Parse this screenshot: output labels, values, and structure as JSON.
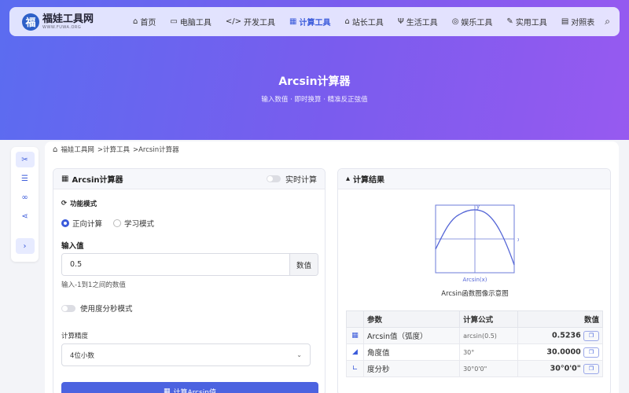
{
  "site": {
    "name": "福娃工具网",
    "sub": "WWW.FUWA.ORG",
    "badge": "福"
  },
  "nav": [
    {
      "icon": "home-icon",
      "glyph": "⌂",
      "label": "首页"
    },
    {
      "icon": "desktop-icon",
      "glyph": "▭",
      "label": "电脑工具"
    },
    {
      "icon": "code-icon",
      "glyph": "</>",
      "label": "开发工具"
    },
    {
      "icon": "calculator-icon",
      "glyph": "▦",
      "label": "计算工具"
    },
    {
      "icon": "store-icon",
      "glyph": "⌂",
      "label": "站长工具"
    },
    {
      "icon": "utensils-icon",
      "glyph": "Ψ",
      "label": "生活工具"
    },
    {
      "icon": "gamepad-icon",
      "glyph": "◎",
      "label": "娱乐工具"
    },
    {
      "icon": "wrench-icon",
      "glyph": "✎",
      "label": "实用工具"
    },
    {
      "icon": "table-icon",
      "glyph": "▤",
      "label": "对照表"
    }
  ],
  "hero": {
    "title": "Arcsin计算器",
    "subtitle": "输入数值 · 即时换算 · 精准反正弦值"
  },
  "breadcrumb": {
    "home": "福娃工具网",
    "cat": ">计算工具",
    "page": ">Arcsin计算器"
  },
  "calc": {
    "title": "Arcsin计算器",
    "realtime": "实时计算",
    "mode_label": "功能模式",
    "mode_forward": "正向计算",
    "mode_learn": "学习模式",
    "input_label": "输入值",
    "input_value": "0.5",
    "input_addon": "数值",
    "hint": "输入-1到1之间的数值",
    "dms_label": "使用度分秒模式",
    "precision_label": "计算精度",
    "precision_value": "4位小数",
    "button": "计算Arcsin值"
  },
  "result": {
    "title": "计算结果",
    "graph_caption": "Arcsin函数图像示意图",
    "graph_x": "x",
    "graph_y": "y",
    "graph_label": "Arcsin(x)",
    "headers": {
      "param": "参数",
      "formula": "计算公式",
      "value": "数值"
    },
    "rows": [
      {
        "param": "Arcsin值（弧度）",
        "formula": "arcsin(0.5)",
        "value": "0.5236"
      },
      {
        "param": "角度值",
        "formula": "30°",
        "value": "30.0000"
      },
      {
        "param": "度分秒",
        "formula": "30°0'0\"",
        "value": "30°0'0\""
      }
    ]
  }
}
